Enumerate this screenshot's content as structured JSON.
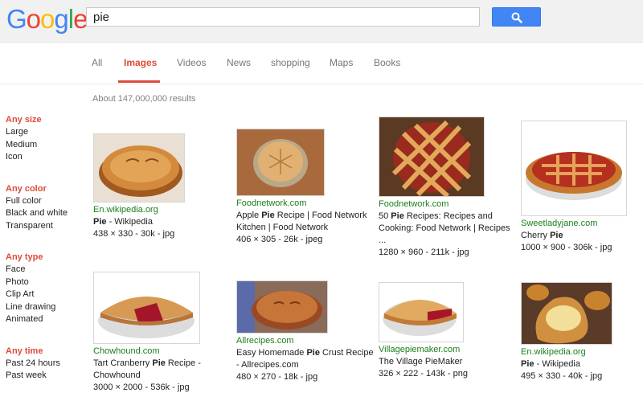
{
  "logo": {
    "letters": [
      "G",
      "o",
      "o",
      "g",
      "l",
      "e"
    ],
    "colors": [
      "#4285f4",
      "#ea4335",
      "#fbbc05",
      "#4285f4",
      "#34a853",
      "#ea4335"
    ]
  },
  "search": {
    "query": "pie"
  },
  "tabs": [
    {
      "label": "All"
    },
    {
      "label": "Images"
    },
    {
      "label": "Videos"
    },
    {
      "label": "News"
    },
    {
      "label": "shopping"
    },
    {
      "label": "Maps"
    },
    {
      "label": "Books"
    }
  ],
  "results_count": "About 147,000,000 results",
  "filters": {
    "size": {
      "title": "Any size",
      "items": [
        "Large",
        "Medium",
        "Icon"
      ]
    },
    "color": {
      "title": "Any color",
      "items": [
        "Full color",
        "Black and white",
        "Transparent"
      ]
    },
    "type": {
      "title": "Any type",
      "items": [
        "Face",
        "Photo",
        "Clip Art",
        "Line drawing",
        "Animated"
      ]
    },
    "time": {
      "title": "Any time",
      "items": [
        "Past 24 hours",
        "Past week"
      ]
    }
  },
  "results": [
    {
      "source": "En.wikipedia.org",
      "title_parts": [
        "",
        "Pie",
        " - Wikipedia"
      ],
      "title_line2": "",
      "meta": "438 × 330 - 30k - jpg"
    },
    {
      "source": "Foodnetwork.com",
      "title_parts": [
        "Apple ",
        "Pie",
        " Recipe | Food Network"
      ],
      "title_line2": "Kitchen | Food Network",
      "meta": "406 × 305 - 26k - jpeg"
    },
    {
      "source": "Foodnetwork.com",
      "title_parts": [
        "50 ",
        "Pie",
        " Recipes: Recipes and"
      ],
      "title_line2": "Cooking: Food Network | Recipes",
      "title_line3": "...",
      "meta": "1280 × 960 - 211k - jpg"
    },
    {
      "source": "Sweetladyjane.com",
      "title_parts": [
        "Cherry ",
        "Pie",
        ""
      ],
      "title_line2": "",
      "meta": "1000 × 900 - 306k - jpg"
    },
    {
      "source": "Chowhound.com",
      "title_parts": [
        "Tart Cranberry ",
        "Pie",
        " Recipe -"
      ],
      "title_line2": "Chowhound",
      "meta": "3000 × 2000 - 536k - jpg"
    },
    {
      "source": "Allrecipes.com",
      "title_parts": [
        "Easy Homemade ",
        "Pie",
        " Crust Recipe"
      ],
      "title_line2": "- Allrecipes.com",
      "meta": "480 × 270 - 18k - jpg"
    },
    {
      "source": "Villagepiemaker.com",
      "title_parts": [
        "The Village PieMaker",
        "",
        ""
      ],
      "title_line2": "",
      "meta": "326 × 222 - 143k - png"
    },
    {
      "source": "En.wikipedia.org",
      "title_parts": [
        "",
        "Pie",
        " - Wikipedia"
      ],
      "title_line2": "",
      "meta": "495 × 330 - 40k - jpg"
    }
  ],
  "colors": {
    "accent": "#dd4b39",
    "link_green": "#1a7f1a",
    "button_blue": "#4285f4"
  }
}
